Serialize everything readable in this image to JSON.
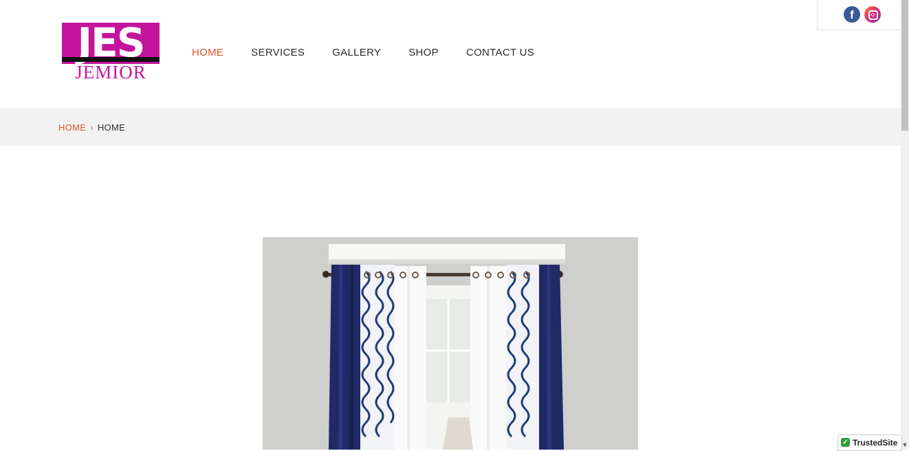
{
  "logo": {
    "top": "JES",
    "bottom": "JEMIOR"
  },
  "nav": {
    "items": [
      "HOME",
      "SERVICES",
      "GALLERY",
      "SHOP",
      "CONTACT US"
    ],
    "active": "HOME"
  },
  "social": {
    "facebook": "f",
    "icons": [
      "facebook-icon",
      "instagram-icon"
    ]
  },
  "breadcrumb": {
    "root": "HOME",
    "separator": "›",
    "current": "HOME"
  },
  "badge": {
    "label": "TrustedSite",
    "check": "✓"
  },
  "colors": {
    "brand": "#c4149c",
    "accent": "#e0542c",
    "navy": "#1f2a66"
  }
}
